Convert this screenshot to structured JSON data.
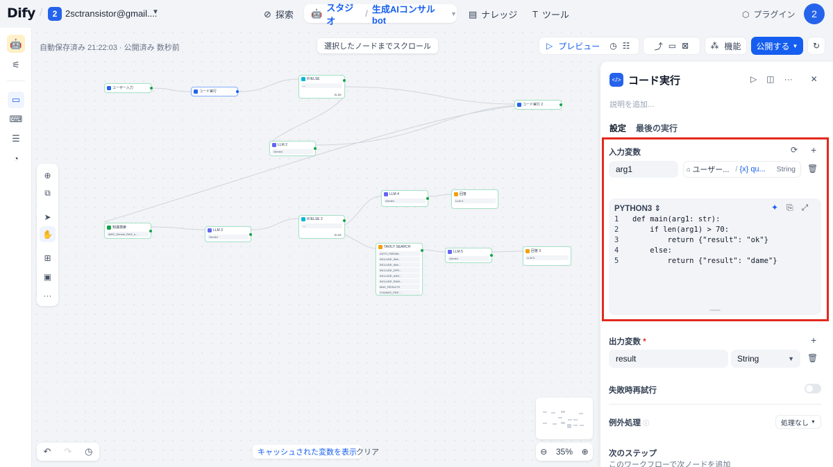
{
  "header": {
    "logo": "Dify",
    "workspace_badge": "2",
    "workspace_name": "2sctransistor@gmail....",
    "nav": {
      "explore": "探索",
      "studio": "スタジオ",
      "app_name": "生成AIコンサルbot",
      "knowledge": "ナレッジ",
      "tools": "ツール"
    },
    "plugin": "プラグイン",
    "avatar": "2"
  },
  "canvas": {
    "autosave": "自動保存済み 21:22:03 · 公開済み 数秒前",
    "scroll_to_node": "選択したノードまでスクロール",
    "preview": "プレビュー",
    "features": "機能",
    "publish": "公開する",
    "cached_vars": "キャッシュされた変数を表示",
    "clear": "クリア",
    "zoom": "35%"
  },
  "nodes": {
    "start": "ユーザー入力",
    "code1": "コード実行",
    "ifelse1": "IF/ELSE",
    "llm2": "LLM 2",
    "code2": "コード実行 2",
    "kb": "知識検索",
    "llm3": "LLM 3",
    "ifelse2": "IF/ELSE 2",
    "llm4": "LLM 4",
    "answer": "回答",
    "tavily": "TAVILY SEARCH",
    "llm5": "LLM 5",
    "answer3": "回答 3",
    "else": "ELSE",
    "gemini": "Gemini",
    "kb_row": "AWS_Gemini_RAG_s...",
    "tavily_rows": [
      "AUTO_PARAM...",
      "INCLUDE_IMA...",
      "INCLUDE_IMA...",
      "INCLUDE_DFR...",
      "INCLUDE_ANS...",
      "INCLUDE_RAW...",
      "MAX_RESULTS",
      "CHUNKS_PER..."
    ]
  },
  "panel": {
    "title": "コード実行",
    "description_placeholder": "説明を追加...",
    "tabs": [
      "設定",
      "最後の実行"
    ],
    "input_vars_label": "入力変数",
    "input_var_name": "arg1",
    "input_var_source": "ユーザー...",
    "input_var_field": "qu...",
    "input_var_type": "String",
    "code_lang": "PYTHON3",
    "code": [
      {
        "n": "1",
        "t": "def main(arg1: str):"
      },
      {
        "n": "2",
        "t": "    if len(arg1) > 70:"
      },
      {
        "n": "3",
        "t": "        return {\"result\": \"ok\"}"
      },
      {
        "n": "4",
        "t": "    else:"
      },
      {
        "n": "5",
        "t": "        return {\"result\": \"dame\"}"
      }
    ],
    "output_vars_label": "出力変数",
    "output_var_name": "result",
    "output_var_type": "String",
    "retry_label": "失敗時再試行",
    "exception_label": "例外処理",
    "exception_value": "処理なし",
    "next_step_label": "次のステップ",
    "next_step_desc": "このワークフローで次ノードを追加"
  },
  "colors": {
    "accent": "#155eef",
    "highlight": "#e3281c"
  }
}
